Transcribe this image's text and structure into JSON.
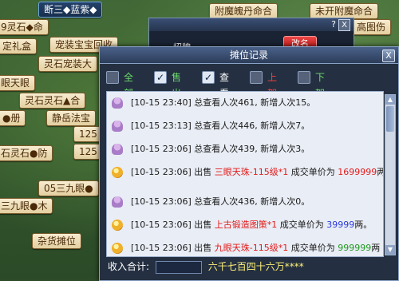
{
  "background_stalls": [
    {
      "label": "断三◆蓝紫◆",
      "style": "top"
    },
    {
      "label": "附魔魄丹命合",
      "style": "light"
    },
    {
      "label": "未开附魔命合",
      "style": "light"
    },
    {
      "label": "9灵石◆命",
      "style": "light"
    },
    {
      "label": "宠装宝宝回收",
      "style": "light"
    },
    {
      "label": "高图伤",
      "style": "light"
    },
    {
      "label": "定礼盒",
      "style": "light"
    },
    {
      "label": "灵石宠装大",
      "style": "light"
    },
    {
      "label": "眼天眼",
      "style": "light"
    },
    {
      "label": "灵石灵石▲合",
      "style": "light"
    },
    {
      "label": "●册",
      "style": "light"
    },
    {
      "label": "静岳法宝",
      "style": "light"
    },
    {
      "label": "石灵石●防",
      "style": "light"
    },
    {
      "label": "125",
      "style": "light"
    },
    {
      "label": "125",
      "style": "light"
    },
    {
      "label": "05三九眼●",
      "style": "light"
    },
    {
      "label": "三九眼●木",
      "style": "light"
    },
    {
      "label": "杂货摊位",
      "style": "light"
    }
  ],
  "back_dialog": {
    "label": "招牌",
    "button_label": "改名",
    "help_icon": "?",
    "close_icon": "X"
  },
  "dialog": {
    "title": "摊位记录",
    "close": "X",
    "filters": [
      {
        "label": "全部",
        "checked": false,
        "color": "#6bd96b"
      },
      {
        "label": "售出",
        "checked": true,
        "color": "#6bd96b"
      },
      {
        "label": "查看",
        "checked": true,
        "color": "#ffffff"
      },
      {
        "label": "上架",
        "checked": false,
        "color": "#ff4040"
      },
      {
        "label": "下架",
        "checked": false,
        "color": "#6bd96b"
      }
    ],
    "records": [
      {
        "icon": "person-icon",
        "text": "[10-15 23:40] 总查看人次461, 新增人次15。"
      },
      {
        "icon": "person-icon",
        "text": "[10-15 23:13] 总查看人次446, 新增人次7。"
      },
      {
        "icon": "person-icon",
        "text": "[10-15 23:06] 总查看人次439, 新增人次3。"
      },
      {
        "icon": "coin-icon",
        "prefix": "[10-15 23:06] 出售 ",
        "item": "三眼天珠-115级*1",
        "item_color": "red",
        "mid": " 成交单价为 ",
        "price": "1699999",
        "price_color": "red",
        "suffix": "两"
      },
      {
        "icon": "person-icon",
        "text": "[10-15 23:06] 总查看人次436, 新增人次0。"
      },
      {
        "icon": "coin-icon",
        "prefix": "[10-15 23:06] 出售 ",
        "item": "上古锻造图策*1",
        "item_color": "red",
        "mid": " 成交单价为 ",
        "price": "39999",
        "price_color": "blue",
        "suffix": "两。"
      },
      {
        "icon": "coin-icon",
        "prefix": "[10-15 23:06] 出售 ",
        "item": "九眼天珠-115级*1",
        "item_color": "red",
        "mid": " 成交单价为 ",
        "price": "999999",
        "price_color": "green",
        "suffix": "两"
      }
    ],
    "income": {
      "label": "收入合计:",
      "amount": "六千七百四十六万****"
    }
  }
}
